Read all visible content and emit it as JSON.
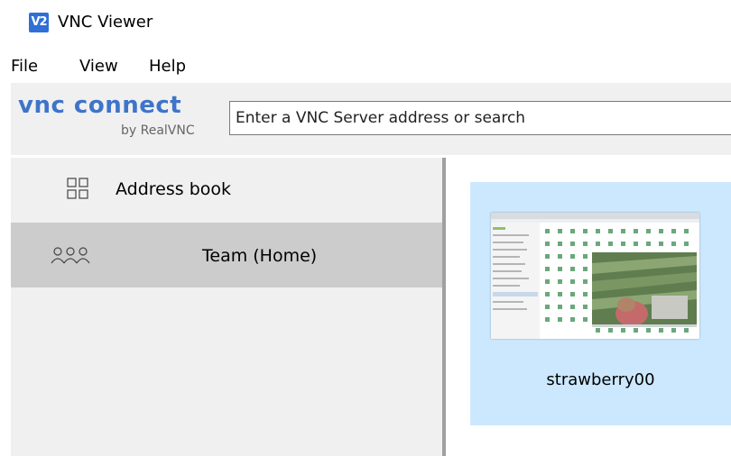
{
  "window": {
    "title": "VNC Viewer",
    "icon_text": "V2"
  },
  "menu": {
    "file": "File",
    "view": "View",
    "help": "Help"
  },
  "logo": {
    "main": "vnc connect",
    "sub": "by RealVNC"
  },
  "search": {
    "placeholder": "Enter a VNC Server address or search",
    "value": ""
  },
  "sidebar": {
    "items": [
      {
        "label": "Address book",
        "icon": "grid-icon",
        "selected": false
      },
      {
        "label": "Team (Home)",
        "icon": "people-icon",
        "selected": true
      }
    ]
  },
  "computers": [
    {
      "name": "strawberry00",
      "selected": true
    }
  ],
  "colors": {
    "accent": "#3e74c9",
    "selected_tile": "#cce8ff",
    "selected_sidebar": "#cccccc",
    "panel_bg": "#f0f0f0"
  }
}
